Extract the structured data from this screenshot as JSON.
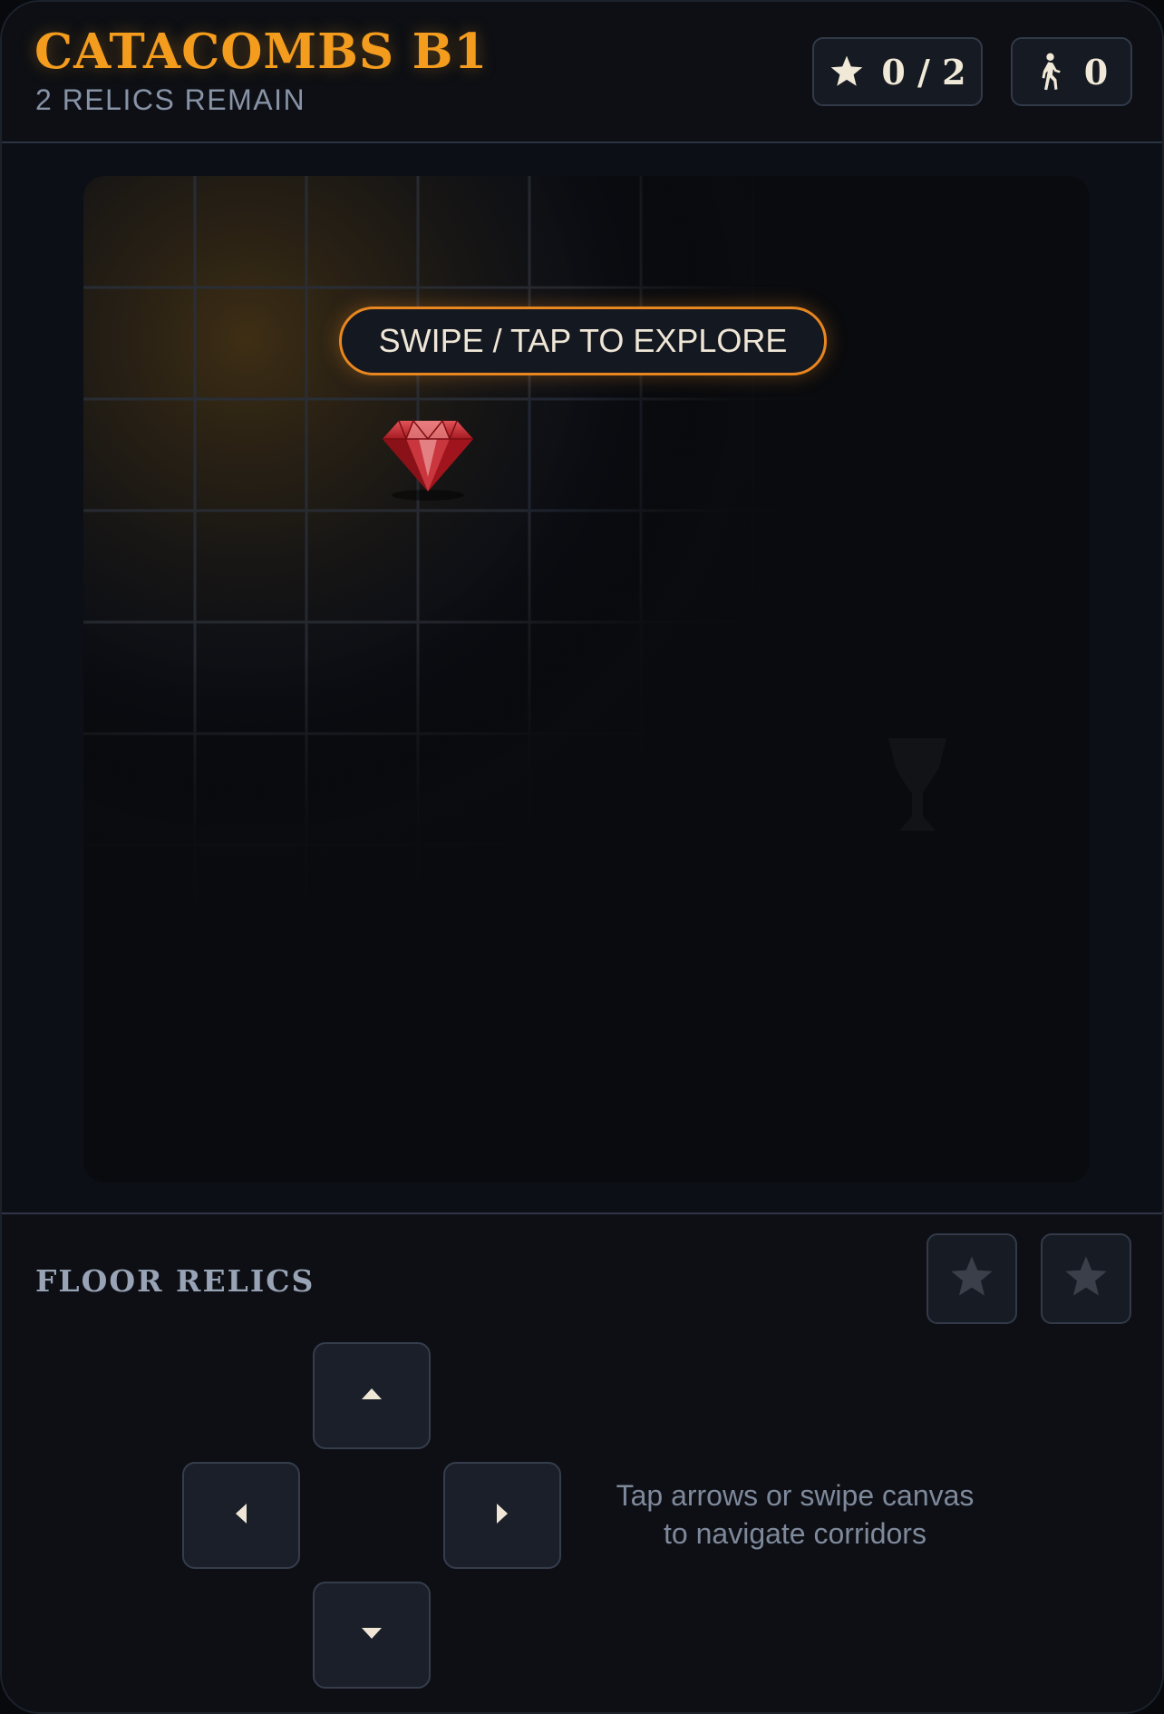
{
  "header": {
    "title": "CATACOMBS B1",
    "subtitle": "2 RELICS REMAIN",
    "relics_counter": "0 / 2",
    "steps_counter": "0",
    "relics_icon": "star-icon",
    "steps_icon": "walking-person-icon"
  },
  "board": {
    "hint": "SWIPE / TAP TO EXPLORE",
    "visible_items": [
      "ruby-gem",
      "goblet-silhouette"
    ]
  },
  "relics": {
    "label": "FLOOR RELICS",
    "slots": [
      {
        "icon": "star-icon",
        "collected": false
      },
      {
        "icon": "star-icon",
        "collected": false
      }
    ]
  },
  "controls": {
    "up_icon": "caret-up-icon",
    "left_icon": "caret-left-icon",
    "right_icon": "caret-right-icon",
    "down_icon": "caret-down-icon",
    "help_line1": "Tap arrows or swipe canvas",
    "help_line2": "to navigate corridors"
  },
  "colors": {
    "accent": "#f39c1d",
    "hint_border": "#e8861f",
    "background": "#0c0e13",
    "gem": "#c0202a"
  }
}
